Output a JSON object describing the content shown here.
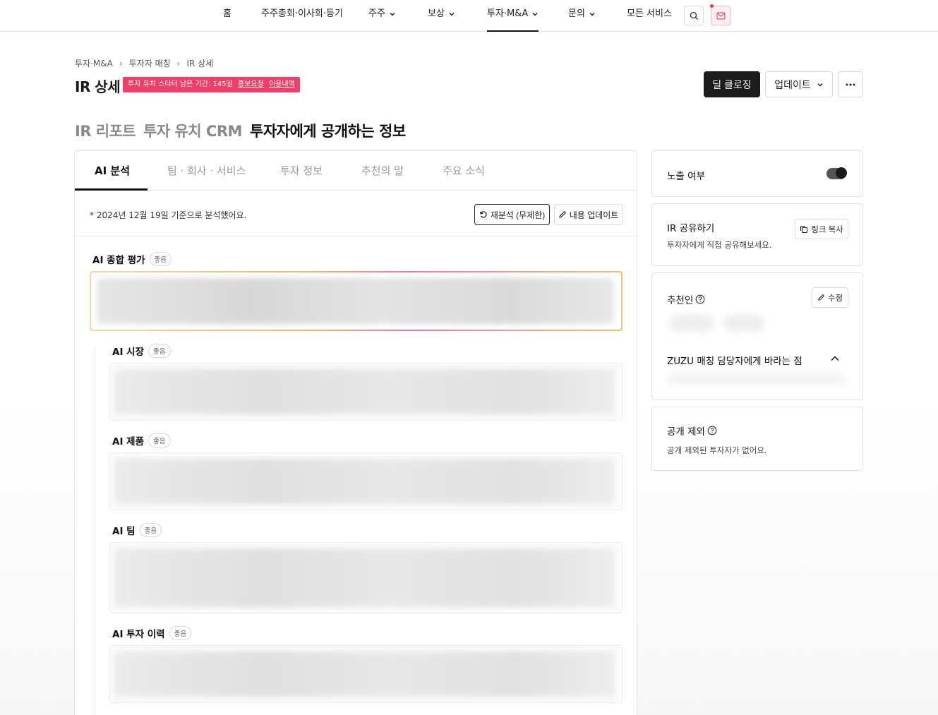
{
  "nav": {
    "items": [
      {
        "label": "홈",
        "has_menu": false
      },
      {
        "label": "주주총회·이사회·등기",
        "has_menu": false
      },
      {
        "label": "주주",
        "has_menu": true
      },
      {
        "label": "보상",
        "has_menu": true
      },
      {
        "label": "투자·M&A",
        "has_menu": true,
        "active": true
      },
      {
        "label": "문의",
        "has_menu": true
      },
      {
        "label": "모든 서비스",
        "has_menu": false
      }
    ]
  },
  "breadcrumb": [
    "투자·M&A",
    "투자자 매칭",
    "IR 상세"
  ],
  "page_title": "IR 상세",
  "promo": {
    "text": "투자 유치 스타터 남은 기간: 145일",
    "link1": "홍보요청",
    "link2": "이용내역"
  },
  "header_actions": {
    "deal_close": "딜 클로징",
    "update": "업데이트"
  },
  "section_tabs": [
    "IR 리포트",
    "투자 유치 CRM",
    "투자자에게 공개하는 정보"
  ],
  "sub_tabs": [
    "AI 분석",
    "팀 · 회사 · 서비스",
    "투자 정보",
    "추천의 말",
    "주요 소식"
  ],
  "analysis": {
    "note": "* 2024년 12월 19일 기준으로 분석했어요.",
    "reanalyze": "재분석 (무제한)",
    "update_content": "내용 업데이트",
    "overall_label": "AI 종합 평가",
    "rating": "좋음",
    "sections": [
      {
        "label": "AI 시장",
        "rating": "좋음"
      },
      {
        "label": "AI 제품",
        "rating": "좋음"
      },
      {
        "label": "AI 팀",
        "rating": "좋음"
      },
      {
        "label": "AI 투자 이력",
        "rating": "좋음"
      }
    ]
  },
  "side": {
    "exposure_label": "노출 여부",
    "exposure_on": true,
    "share_title": "IR 공유하기",
    "share_sub": "투자자에게 직접 공유해보세요.",
    "copy_link": "링크 복사",
    "recommender_title": "추천인",
    "edit": "수정",
    "zuzu_title": "ZUZU 매칭 담당자에게 바라는 점",
    "exclude_title": "공개 제외",
    "exclude_sub": "공개 제외된 투자자가 없어요."
  }
}
